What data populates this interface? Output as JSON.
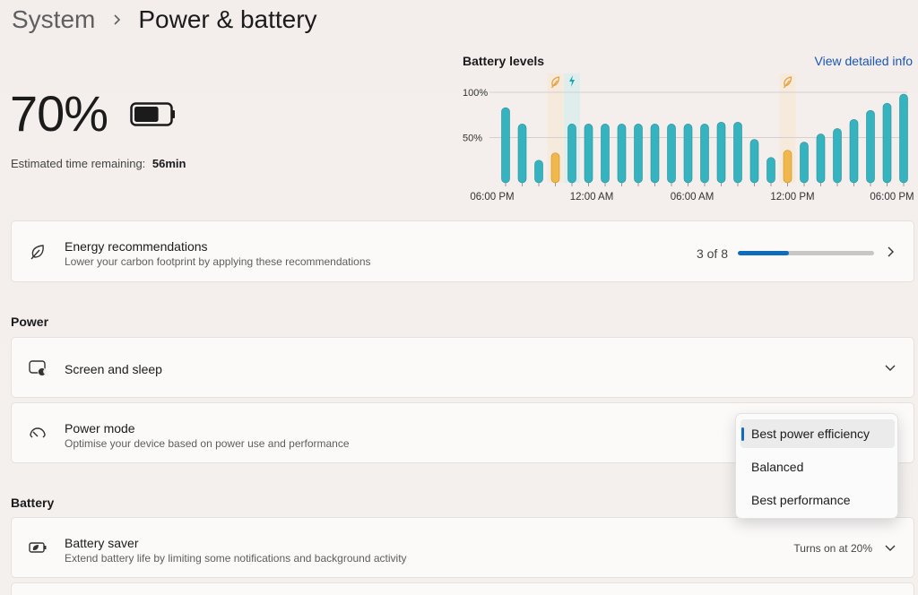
{
  "breadcrumb": {
    "parent": "System",
    "current": "Power & battery"
  },
  "battery": {
    "percent": "70%",
    "level": 0.7,
    "estimate_label": "Estimated time remaining:",
    "estimate_value": "56min"
  },
  "chart": {
    "title": "Battery levels",
    "link": "View detailed info"
  },
  "chart_data": {
    "type": "bar",
    "title": "Battery levels",
    "y_ticks": [
      "100%",
      "50%"
    ],
    "x_ticks": [
      "06:00 PM",
      "12:00 AM",
      "06:00 AM",
      "12:00 PM",
      "06:00 PM"
    ],
    "ylim": [
      0,
      100
    ],
    "values": [
      83,
      65,
      25,
      33,
      65,
      65,
      65,
      65,
      65,
      65,
      65,
      65,
      65,
      67,
      67,
      48,
      28,
      36,
      45,
      54,
      60,
      70,
      80,
      88,
      98
    ],
    "saver_bars": [
      3,
      17
    ],
    "event_markers": [
      {
        "bar": 3,
        "icon": "leaf-icon",
        "color": "#e6a040"
      },
      {
        "bar": 4,
        "icon": "lightning-icon",
        "color": "#1aa6b3"
      },
      {
        "bar": 17,
        "icon": "leaf-icon",
        "color": "#e6a040"
      }
    ],
    "colors": {
      "normal": "#35b4bf",
      "saver": "#f0b84c"
    }
  },
  "energy": {
    "title": "Energy recommendations",
    "subtitle": "Lower your carbon footprint by applying these recommendations",
    "progress_text": "3 of 8",
    "progress": 0.375
  },
  "power_section": "Power",
  "screen_sleep": {
    "title": "Screen and sleep"
  },
  "power_mode": {
    "title": "Power mode",
    "subtitle": "Optimise your device based on power use and performance",
    "options": [
      "Best power efficiency",
      "Balanced",
      "Best performance"
    ],
    "selected": "Best power efficiency"
  },
  "battery_section": "Battery",
  "battery_saver": {
    "title": "Battery saver",
    "subtitle": "Extend battery life by limiting some notifications and background activity",
    "status": "Turns on at 20%"
  }
}
